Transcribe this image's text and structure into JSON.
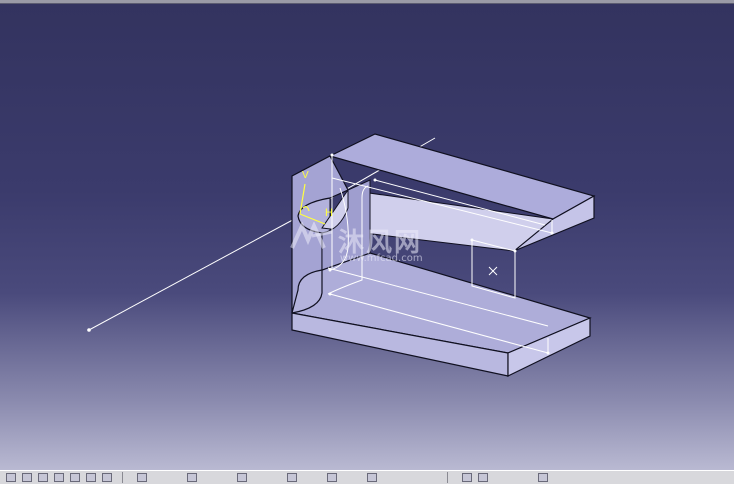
{
  "watermark": {
    "text": "沐风网",
    "url": "www.mfcad.com",
    "logo": "mf-logo-icon"
  },
  "model": {
    "part": "channel-part",
    "compass_axes": [
      "V",
      "H"
    ]
  },
  "colors": {
    "background_top": "#33335f",
    "background_bottom": "#b9b9d2",
    "part_face": "#a9a8d6",
    "part_side": "#c7c6ea",
    "edge": "#101020",
    "wire": "#ffffff",
    "axis": "#ffff40"
  },
  "taskbar": {
    "icons": [
      "file-icon",
      "refresh-icon",
      "print-icon",
      "window-icon",
      "window-icon",
      "window-icon",
      "tool-icon",
      "sketch-icon",
      "view-icon",
      "snap-icon",
      "grid-icon",
      "axis-icon",
      "render-icon",
      "zoom-icon",
      "pan-icon",
      "settings-icon"
    ]
  }
}
